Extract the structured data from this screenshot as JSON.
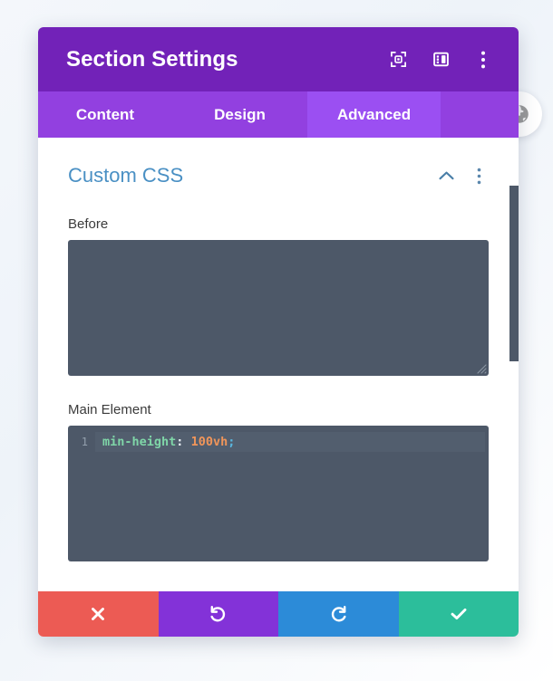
{
  "header": {
    "title": "Section Settings",
    "actions": [
      {
        "name": "focus-icon",
        "label": "Focus"
      },
      {
        "name": "layout-icon",
        "label": "Layout"
      },
      {
        "name": "more-vertical-icon",
        "label": "More options"
      }
    ]
  },
  "tabs": [
    {
      "label": "Content",
      "active": false
    },
    {
      "label": "Design",
      "active": false
    },
    {
      "label": "Advanced",
      "active": true
    }
  ],
  "section": {
    "title": "Custom CSS",
    "collapse_icon": "chevron-up-icon",
    "menu_icon": "more-vertical-icon"
  },
  "fields": {
    "before": {
      "label": "Before",
      "value": "",
      "placeholder": ""
    },
    "main_element": {
      "label": "Main Element",
      "line_number": "1",
      "code": "min-height: 100vh;",
      "tokens": {
        "property": "min-height",
        "colon": ":",
        "value": "100vh",
        "semicolon": ";"
      }
    }
  },
  "footer": {
    "cancel_label": "Cancel",
    "undo_label": "Undo",
    "redo_label": "Redo",
    "save_label": "Save"
  },
  "floating": {
    "globe_label": "Preview"
  },
  "colors": {
    "header_purple": "#7222b8",
    "tabbar_purple": "#9240e0",
    "tab_active_purple": "#9b4ff2",
    "section_title_blue": "#4a90c4",
    "editor_bg": "#4d5868",
    "cancel_red": "#ec5b54",
    "undo_purple": "#8332d8",
    "redo_blue": "#2c8bd8",
    "save_green": "#2cbe9b",
    "token_property": "#7fd6a8",
    "token_value": "#f0955a",
    "token_semicolon": "#5ab8e0"
  }
}
